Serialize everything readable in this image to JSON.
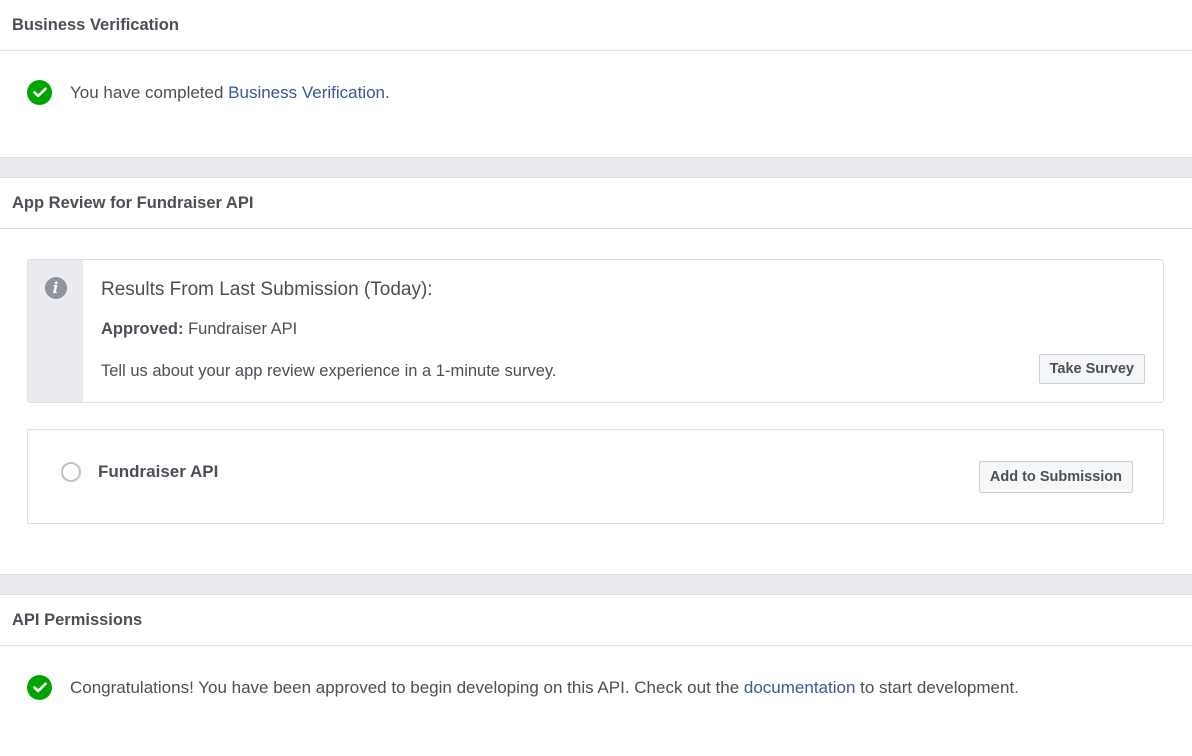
{
  "business_verification": {
    "title": "Business Verification",
    "status_prefix": "You have completed ",
    "status_link": "Business Verification",
    "status_suffix": "."
  },
  "app_review": {
    "title": "App Review for Fundraiser API",
    "info": {
      "icon": "info-icon",
      "heading": "Results From Last Submission (Today):",
      "approved_label": "Approved:",
      "approved_value": " Fundraiser API",
      "survey_text": "Tell us about your app review experience in a 1-minute survey.",
      "survey_button": "Take Survey"
    },
    "api_item": {
      "name": "Fundraiser API",
      "selected": false,
      "button": "Add to Submission"
    }
  },
  "api_permissions": {
    "title": "API Permissions",
    "status_prefix": "Congratulations! You have been approved to begin developing on this API. Check out the ",
    "status_link": "documentation",
    "status_suffix": " to start development."
  },
  "colors": {
    "success": "#00a400",
    "link": "#385898",
    "muted_text": "#4b4f56",
    "divider": "#dddfe2",
    "gap_background": "#e9ebee"
  }
}
